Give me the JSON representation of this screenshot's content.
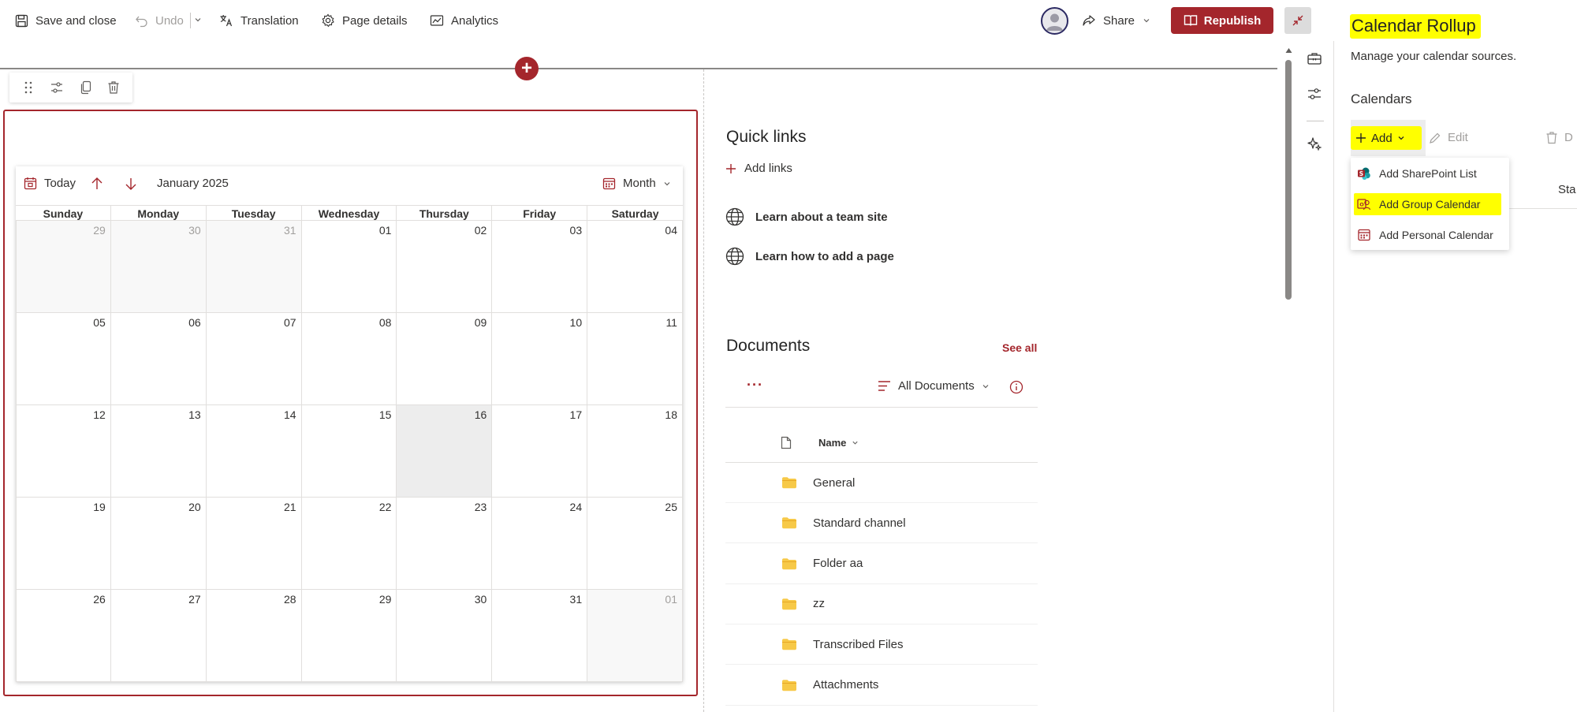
{
  "toolbar": {
    "save_close": "Save and close",
    "undo": "Undo",
    "translation": "Translation",
    "page_details": "Page details",
    "analytics": "Analytics",
    "share": "Share",
    "republish": "Republish"
  },
  "calendar": {
    "today_label": "Today",
    "month_year": "January 2025",
    "view_label": "Month",
    "weekdays": [
      "Sunday",
      "Monday",
      "Tuesday",
      "Wednesday",
      "Thursday",
      "Friday",
      "Saturday"
    ],
    "weeks": [
      [
        "29",
        "30",
        "31",
        "01",
        "02",
        "03",
        "04"
      ],
      [
        "05",
        "06",
        "07",
        "08",
        "09",
        "10",
        "11"
      ],
      [
        "12",
        "13",
        "14",
        "15",
        "16",
        "17",
        "18"
      ],
      [
        "19",
        "20",
        "21",
        "22",
        "23",
        "24",
        "25"
      ],
      [
        "26",
        "27",
        "28",
        "29",
        "30",
        "31",
        "01"
      ]
    ]
  },
  "quick_links": {
    "title": "Quick links",
    "add_label": "Add links",
    "items": [
      "Learn about a team site",
      "Learn how to add a page"
    ]
  },
  "documents": {
    "title": "Documents",
    "see_all": "See all",
    "more": "···",
    "view": "All Documents",
    "column_name": "Name",
    "items": [
      "General",
      "Standard channel",
      "Folder aa",
      "zz",
      "Transcribed Files",
      "Attachments"
    ]
  },
  "pane": {
    "title": "Calendar Rollup",
    "description": "Manage your calendar sources.",
    "section": "Calendars",
    "add": "Add",
    "edit": "Edit",
    "delete_partial": "D",
    "status_partial": "Sta",
    "menu": [
      "Add SharePoint List",
      "Add Group Calendar",
      "Add Personal Calendar"
    ]
  },
  "colors": {
    "accent": "#a4262c",
    "highlight": "#ffff00",
    "folder": "#f7c948"
  }
}
